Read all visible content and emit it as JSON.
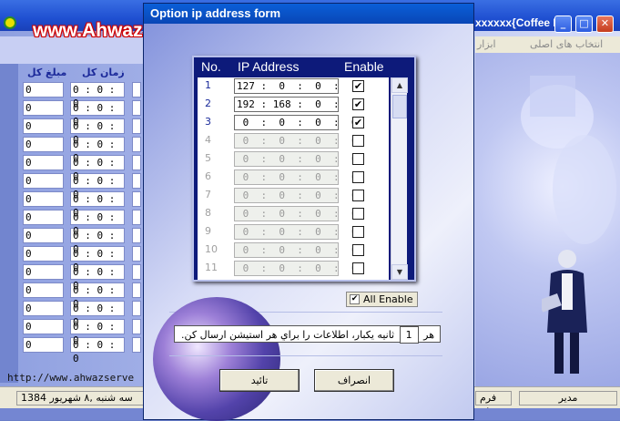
{
  "main_window": {
    "caption": "xxxxxx{Coffee N",
    "watermark": "www.AhwazServer.com/CNT/",
    "menu": [
      "ابزار",
      "انتخاب های اصلی"
    ],
    "col_headers": [
      "مبلغ کل",
      "زمان کل"
    ],
    "amount_value": "0",
    "time_value": "0 : 0 : 0",
    "status_url": "http://www.ahwazserve",
    "status_date": "سه شنبه ,۸ شهریور 1384",
    "status_form": "فرم فر",
    "status_user": "مدیر"
  },
  "dialog": {
    "title": "Option ip address form",
    "header_no": "No.",
    "header_ip": "IP Address",
    "header_enable": "Enable",
    "rows": [
      {
        "no": "1",
        "ip": "127 :  0  :  0  :  1",
        "enabled": true,
        "active": true
      },
      {
        "no": "2",
        "ip": "192 : 168 :  0  :  1|",
        "enabled": true,
        "active": true
      },
      {
        "no": "3",
        "ip": " 0  :  0  :  0  :  0",
        "enabled": true,
        "active": true
      },
      {
        "no": "4",
        "ip": " 0  :  0  :  0  :  0",
        "enabled": false,
        "active": false
      },
      {
        "no": "5",
        "ip": " 0  :  0  :  0  :  0",
        "enabled": false,
        "active": false
      },
      {
        "no": "6",
        "ip": " 0  :  0  :  0  :  0",
        "enabled": false,
        "active": false
      },
      {
        "no": "7",
        "ip": " 0  :  0  :  0  :  0",
        "enabled": false,
        "active": false
      },
      {
        "no": "8",
        "ip": " 0  :  0  :  0  :  0",
        "enabled": false,
        "active": false
      },
      {
        "no": "9",
        "ip": " 0  :  0  :  0  :  0",
        "enabled": false,
        "active": false
      },
      {
        "no": "10",
        "ip": " 0  :  0  :  0  :  0",
        "enabled": false,
        "active": false
      },
      {
        "no": "11",
        "ip": " 0  :  0  :  0  :  0",
        "enabled": false,
        "active": false
      }
    ],
    "all_enable_label": "All Enable",
    "all_enable_checked": true,
    "interval_prefix": "هر",
    "interval_value": "1",
    "interval_text": "ثانيه يکبار، اطلاعات را براي هر استيشن ارسال کن.",
    "ok_label": "تائيد",
    "cancel_label": "انصراف"
  },
  "colors": {
    "title_blue": "#0a5fd8",
    "panel_navy": "#0d1a7a",
    "watermark_red": "#d00000"
  }
}
